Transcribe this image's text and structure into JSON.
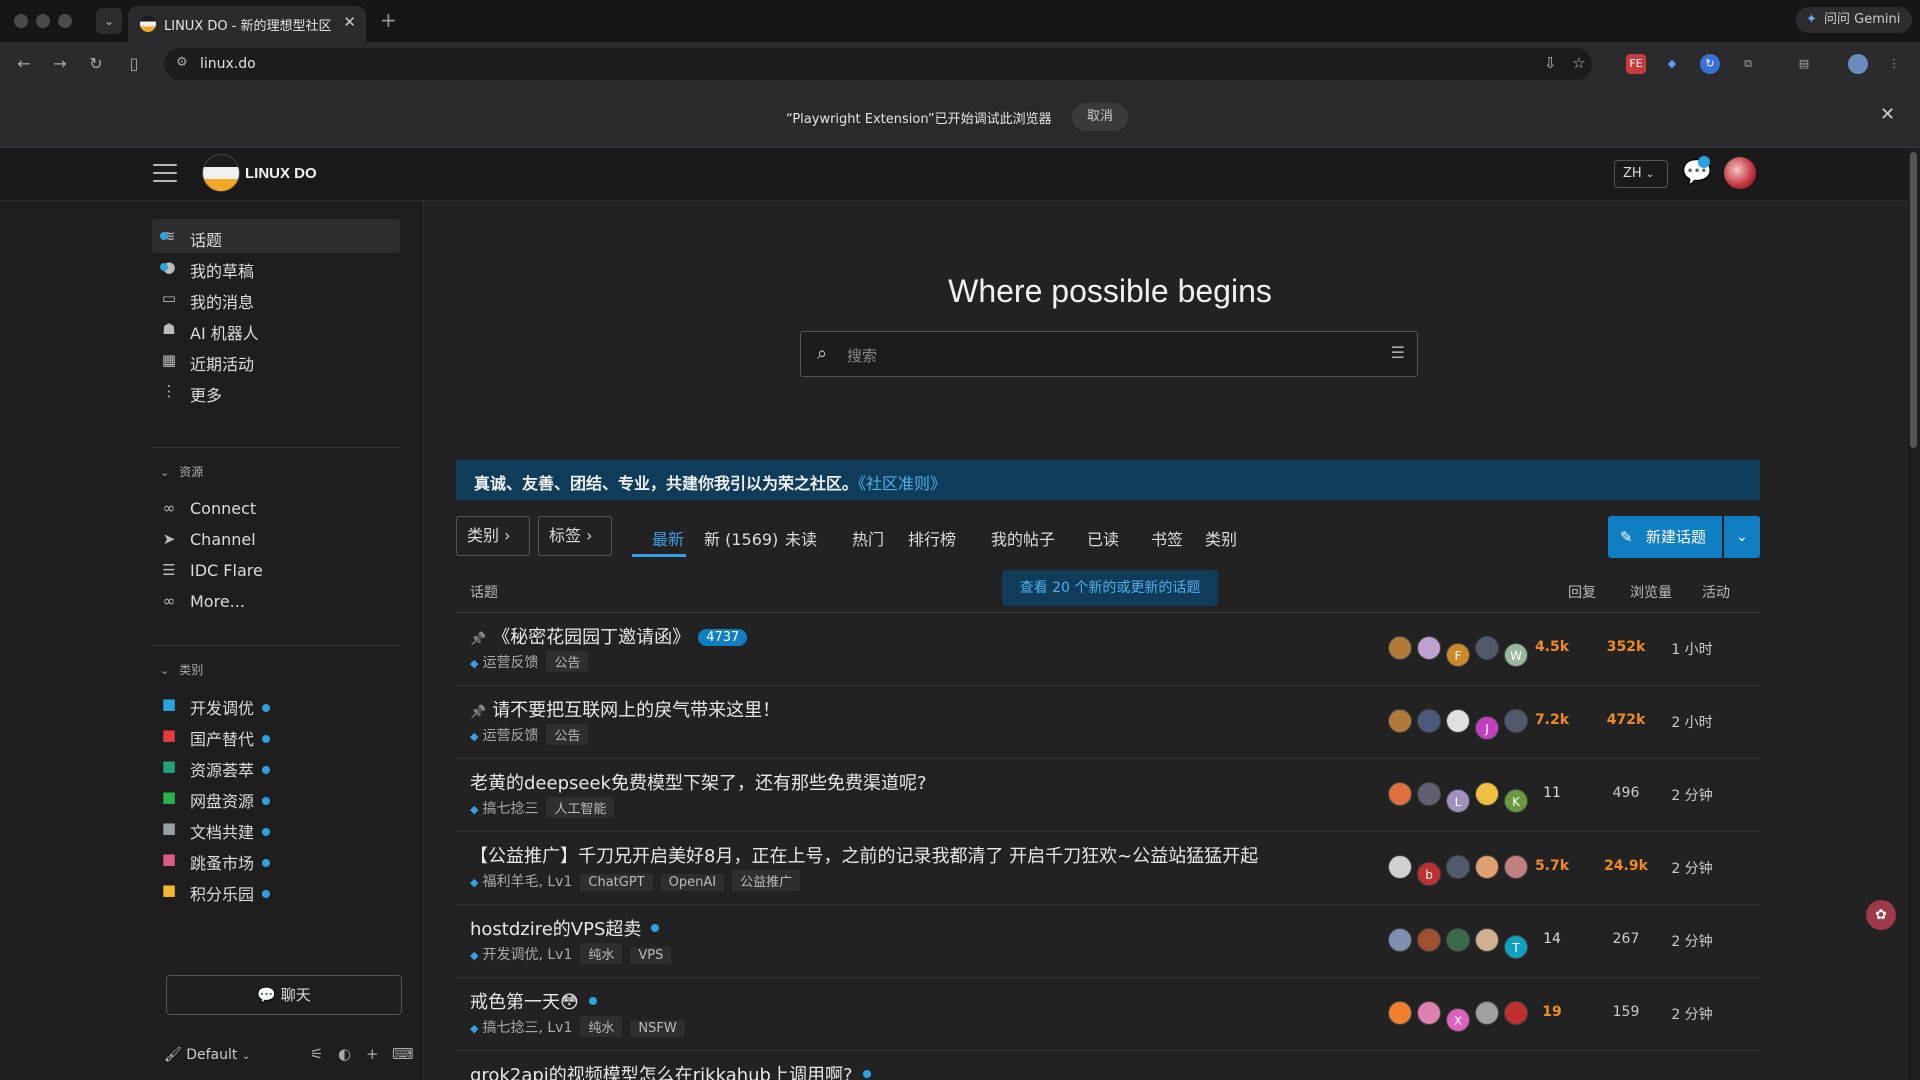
{
  "browser": {
    "tab_title": "LINUX DO - 新的理想型社区",
    "url": "linux.do",
    "gemini_label": "问问 Gemini",
    "extension_badge": "FE"
  },
  "infobar": {
    "message": "“Playwright Extension”已开始调试此浏览器",
    "cancel_label": "取消"
  },
  "header": {
    "logo_text": "LINUX DO",
    "lang": "ZH"
  },
  "sidebar": {
    "items": [
      {
        "label": "话题",
        "icon": "layers-icon",
        "dot": true
      },
      {
        "label": "我的草稿",
        "icon": "user-icon",
        "dot": true
      },
      {
        "label": "我的消息",
        "icon": "inbox-icon",
        "dot": false
      },
      {
        "label": "AI 机器人",
        "icon": "robot-icon",
        "dot": false
      },
      {
        "label": "近期活动",
        "icon": "calendar-icon",
        "dot": false
      },
      {
        "label": "更多",
        "icon": "more-vertical-icon",
        "dot": false
      }
    ],
    "resources_title": "资源",
    "resources": [
      {
        "label": "Connect",
        "icon": "link-icon"
      },
      {
        "label": "Channel",
        "icon": "send-icon"
      },
      {
        "label": "IDC Flare",
        "icon": "server-icon"
      },
      {
        "label": "More...",
        "icon": "infinity-icon"
      }
    ],
    "categories_title": "类别",
    "categories": [
      {
        "label": "开发调优",
        "color": "#2aa3e0"
      },
      {
        "label": "国产替代",
        "color": "#e53b3b"
      },
      {
        "label": "资源荟萃",
        "color": "#1fa37a"
      },
      {
        "label": "网盘资源",
        "color": "#2bb24c"
      },
      {
        "label": "文档共建",
        "color": "#9aa0a6"
      },
      {
        "label": "跳蚤市场",
        "color": "#e05a8a"
      },
      {
        "label": "积分乐园",
        "color": "#f2b830"
      }
    ],
    "chat_label": "聊天",
    "theme_label": "Default"
  },
  "main": {
    "hero": "Where possible begins",
    "search_placeholder": "搜索",
    "banner_text": "真诚、友善、团结、专业，共建你我引以为荣之社区。",
    "banner_link": "《社区准则》",
    "filters": {
      "category": "类别",
      "tag": "标签"
    },
    "nav_tabs": [
      "最新",
      "新 (1569)",
      "未读",
      "热门",
      "排行榜",
      "我的帖子",
      "已读",
      "书签",
      "类别"
    ],
    "new_topic_label": "新建话题",
    "new_topics_notice": "查看 20 个新的或更新的话题",
    "columns": {
      "topic": "话题",
      "replies": "回复",
      "views": "浏览量",
      "activity": "活动"
    }
  },
  "topics": [
    {
      "title": "《秘密花园园丁邀请函》",
      "pinned": true,
      "count": "4737",
      "newdot": false,
      "category": "运营反馈",
      "tags": [
        "公告"
      ],
      "replies": "4.5k",
      "views": "352k",
      "activity": "1 小时",
      "hot_rep": true,
      "hot_views": true,
      "avatars": [
        [
          "#b07a3a",
          ""
        ],
        [
          "#c0a0d0",
          ""
        ],
        [
          "#c88a2a",
          "F"
        ],
        [
          "#505a6a",
          ""
        ],
        [
          "#9ab8a0",
          "W"
        ]
      ]
    },
    {
      "title": "请不要把互联网上的戾气带来这里！",
      "pinned": true,
      "count": "",
      "newdot": false,
      "category": "运营反馈",
      "tags": [
        "公告"
      ],
      "replies": "7.2k",
      "views": "472k",
      "activity": "2 小时",
      "hot_rep": true,
      "hot_views": true,
      "avatars": [
        [
          "#b07a3a",
          ""
        ],
        [
          "#4a5a7a",
          ""
        ],
        [
          "#e0e0e0",
          ""
        ],
        [
          "#c040c0",
          "J"
        ],
        [
          "#505a6a",
          ""
        ]
      ]
    },
    {
      "title": "老黄的deepseek免费模型下架了，还有那些免费渠道呢?",
      "pinned": false,
      "count": "",
      "newdot": false,
      "category": "搞七捻三",
      "tags": [
        "人工智能"
      ],
      "replies": "11",
      "views": "496",
      "activity": "2 分钟",
      "hot_rep": false,
      "hot_views": false,
      "avatars": [
        [
          "#e07040",
          ""
        ],
        [
          "#606070",
          ""
        ],
        [
          "#a090c0",
          "L"
        ],
        [
          "#f0c040",
          ""
        ],
        [
          "#6a9a40",
          "K"
        ]
      ]
    },
    {
      "title": "【公益推广】千刀兄开启美好8月，正在上号，之前的记录我都清了 开启千刀狂欢~公益站猛猛开起",
      "pinned": false,
      "count": "",
      "newdot": false,
      "category": "福利羊毛, Lv1",
      "tags": [
        "ChatGPT",
        "OpenAI",
        "公益推广"
      ],
      "replies": "5.7k",
      "views": "24.9k",
      "activity": "2 分钟",
      "hot_rep": true,
      "hot_views": true,
      "avatars": [
        [
          "#d0d0d0",
          ""
        ],
        [
          "#c03030",
          "b"
        ],
        [
          "#505a6a",
          ""
        ],
        [
          "#e0a070",
          ""
        ],
        [
          "#c08080",
          ""
        ]
      ]
    },
    {
      "title": "hostdzire的VPS超卖",
      "pinned": false,
      "count": "",
      "newdot": true,
      "category": "开发调优, Lv1",
      "tags": [
        "纯水",
        "VPS"
      ],
      "replies": "14",
      "views": "267",
      "activity": "2 分钟",
      "hot_rep": false,
      "hot_views": false,
      "avatars": [
        [
          "#8090b0",
          ""
        ],
        [
          "#a05030",
          ""
        ],
        [
          "#3a6a4a",
          ""
        ],
        [
          "#d0b090",
          ""
        ],
        [
          "#10a0c0",
          "T"
        ]
      ]
    },
    {
      "title": "戒色第一天😳",
      "pinned": false,
      "count": "",
      "newdot": true,
      "category": "搞七捻三, Lv1",
      "tags": [
        "纯水",
        "NSFW"
      ],
      "replies": "19",
      "views": "159",
      "activity": "2 分钟",
      "hot_rep": true,
      "hot_views": false,
      "avatars": [
        [
          "#f08030",
          ""
        ],
        [
          "#e080b0",
          ""
        ],
        [
          "#e060c0",
          "X"
        ],
        [
          "#a0a0a0",
          ""
        ],
        [
          "#c03030",
          ""
        ]
      ]
    },
    {
      "title": "grok2api的视频模型怎么在rikkahub上调用啊?",
      "pinned": false,
      "count": "",
      "newdot": true,
      "category": "",
      "tags": [],
      "replies": "",
      "views": "",
      "activity": "",
      "hot_rep": false,
      "hot_views": false,
      "avatars": []
    }
  ]
}
